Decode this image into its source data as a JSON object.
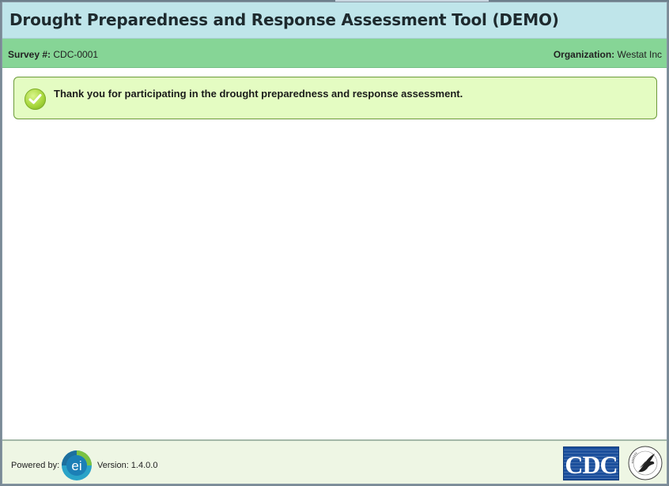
{
  "window": {
    "title": "Drought Preparedness and Response Assessment Tool (DEMO)"
  },
  "info_bar": {
    "survey_label": "Survey #:",
    "survey_value": "CDC-0001",
    "organization_label": "Organization:",
    "organization_value": "Westat Inc"
  },
  "message": {
    "icon": "check-circle-icon",
    "text": "Thank you for participating in the drought preparedness and response assessment."
  },
  "footer": {
    "powered_by_label": "Powered by:",
    "powered_by_logo_text": "ei",
    "version_text": "Version: 1.4.0.0",
    "cdc_logo_text": "CDC",
    "hhs_logo": "hhs-eagle-logo"
  },
  "colors": {
    "title_bar": "#bfe5ea",
    "info_bar": "#86d596",
    "message_bg": "#e4fcc2",
    "message_border": "#6c9a3a",
    "footer_bg": "#eef6e4",
    "cdc_blue": "#1b4f9c"
  }
}
